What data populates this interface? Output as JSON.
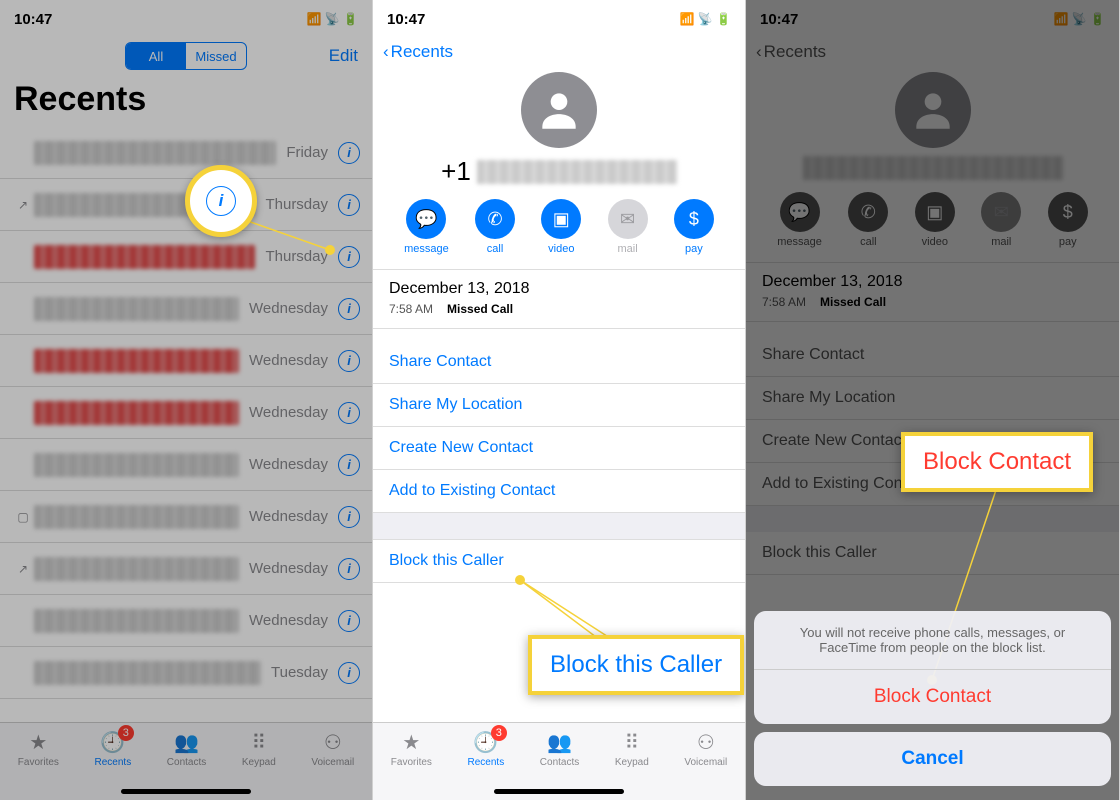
{
  "status": {
    "time": "10:47",
    "signal": "▪▪",
    "wifi": "✓",
    "battery": "■"
  },
  "panel1": {
    "segmented": {
      "all": "All",
      "missed": "Missed"
    },
    "edit": "Edit",
    "title": "Recents",
    "rows": [
      {
        "day": "Friday",
        "missed": false
      },
      {
        "day": "Thursday",
        "missed": false,
        "icon": "phone-out"
      },
      {
        "day": "Thursday",
        "missed": true
      },
      {
        "day": "Wednesday",
        "missed": false
      },
      {
        "day": "Wednesday",
        "missed": true
      },
      {
        "day": "Wednesday",
        "missed": true
      },
      {
        "day": "Wednesday",
        "missed": false
      },
      {
        "day": "Wednesday",
        "missed": false,
        "icon": "video"
      },
      {
        "day": "Wednesday",
        "missed": false,
        "icon": "phone-out"
      },
      {
        "day": "Wednesday",
        "missed": false
      },
      {
        "day": "Tuesday",
        "missed": false
      }
    ]
  },
  "tabs": {
    "favorites": "Favorites",
    "recents": "Recents",
    "recents_badge": "3",
    "contacts": "Contacts",
    "keypad": "Keypad",
    "voicemail": "Voicemail"
  },
  "panel2": {
    "back": "Recents",
    "number_prefix": "+1",
    "actions": {
      "message": "message",
      "call": "call",
      "video": "video",
      "mail": "mail",
      "pay": "pay"
    },
    "date": "December 13, 2018",
    "time": "7:58 AM",
    "type": "Missed Call",
    "share_contact": "Share Contact",
    "share_location": "Share My Location",
    "create_contact": "Create New Contact",
    "add_existing": "Add to Existing Contact",
    "block": "Block this Caller"
  },
  "panel3": {
    "sheet_msg": "You will not receive phone calls, messages, or FaceTime from people on the block list.",
    "block_contact": "Block Contact",
    "cancel": "Cancel"
  },
  "callouts": {
    "info": "i",
    "block_this_caller": "Block this Caller",
    "block_contact": "Block Contact"
  }
}
